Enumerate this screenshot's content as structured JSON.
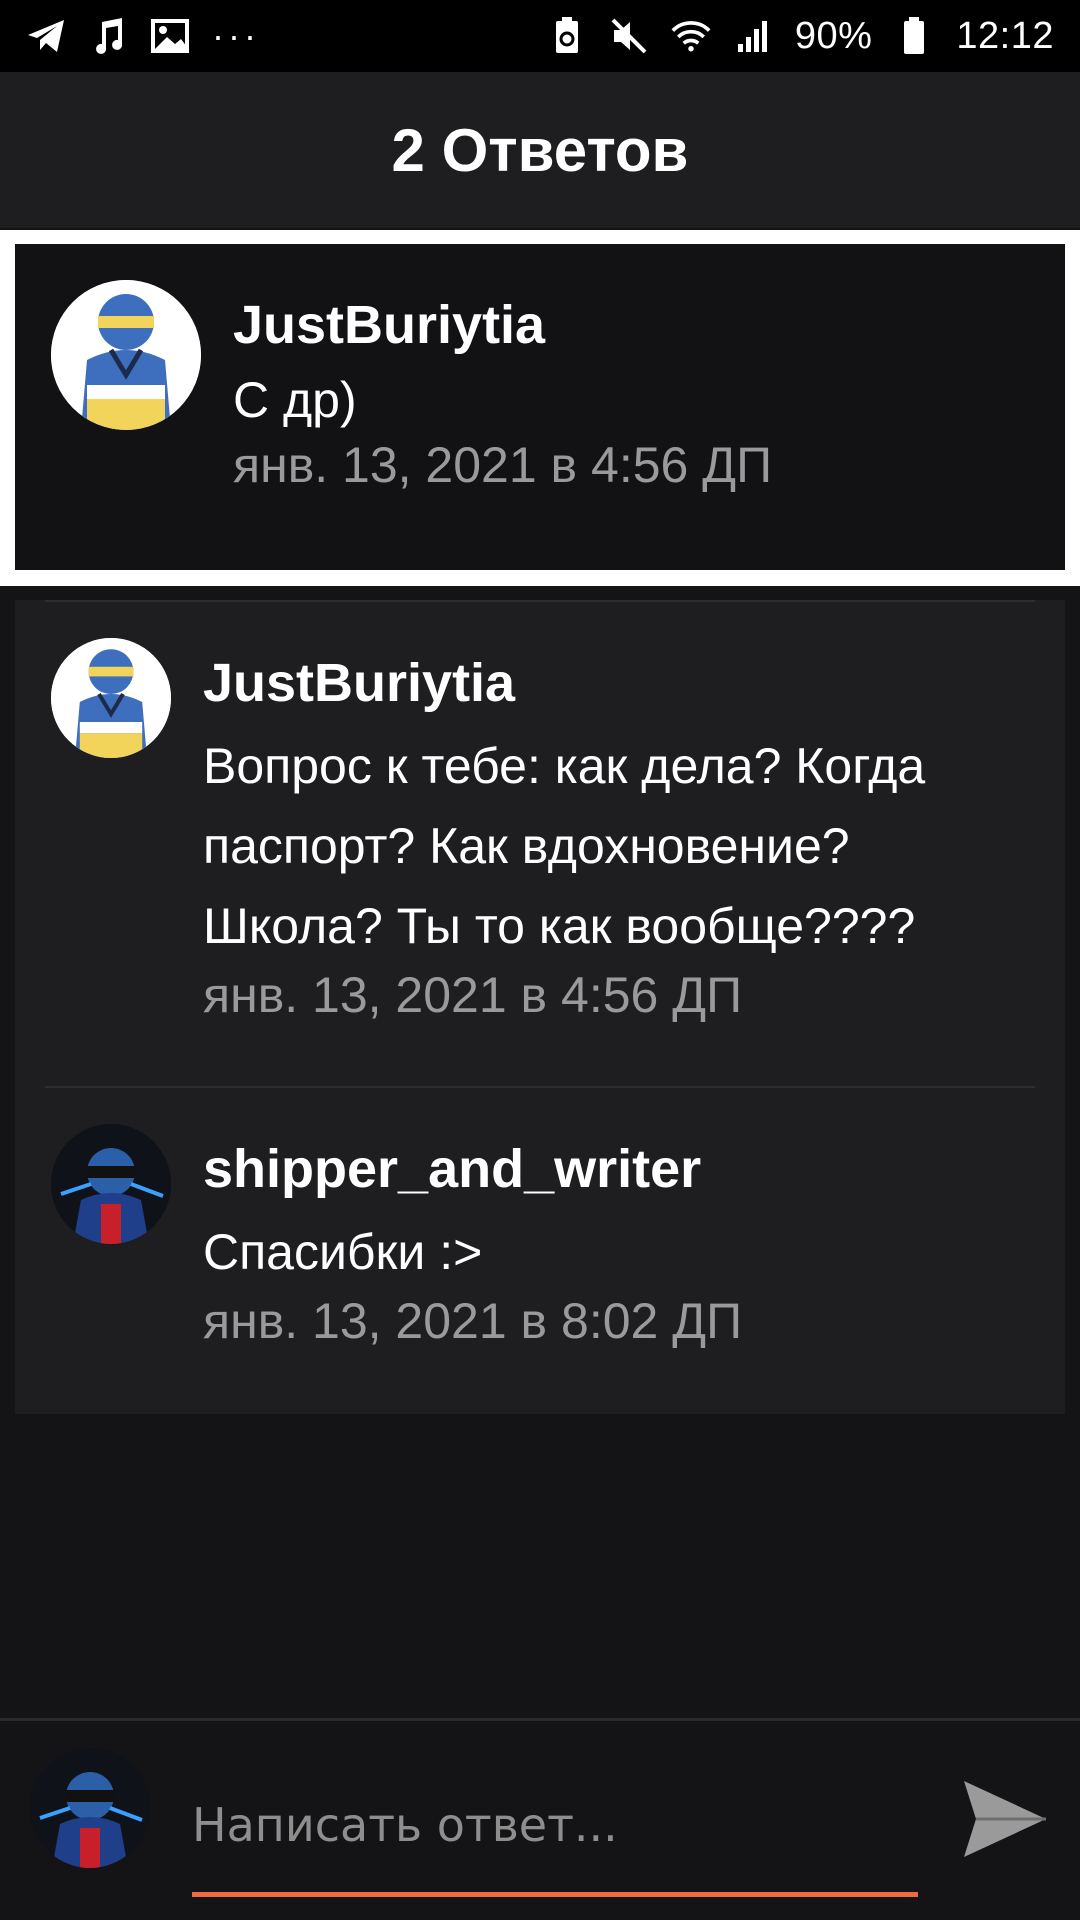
{
  "status_bar": {
    "battery": "90%",
    "time": "12:12",
    "icons_left": [
      "telegram-icon",
      "music-icon",
      "image-icon",
      "more-icon"
    ],
    "icons_right": [
      "battery-saver-icon",
      "mute-icon",
      "wifi-icon",
      "signal-icon",
      "battery-icon"
    ],
    "more": "···"
  },
  "header": {
    "title": "2 Ответов"
  },
  "parent_comment": {
    "author": "JustBuriytia",
    "text": "С др)",
    "date": "янв. 13, 2021 в 4:56 ДП"
  },
  "replies": [
    {
      "author": "JustBuriytia",
      "text_lines": [
        "Вопрос к тебе: как дела? Когда",
        "паспорт? Как вдохновение?",
        "Школа? Ты то как вообще????"
      ],
      "date": "янв. 13, 2021 в 4:56 ДП"
    },
    {
      "author": "shipper_and_writer",
      "text_lines": [
        "Спасибки :>"
      ],
      "date": "янв. 13, 2021 в 8:02 ДП"
    }
  ],
  "composer": {
    "placeholder": "Написать ответ...",
    "accent_color": "#f06a3d"
  },
  "colors": {
    "background": "#141316",
    "header": "#1e1e20",
    "panel": "#1e1e21",
    "date_text": "#9a9a9a"
  }
}
